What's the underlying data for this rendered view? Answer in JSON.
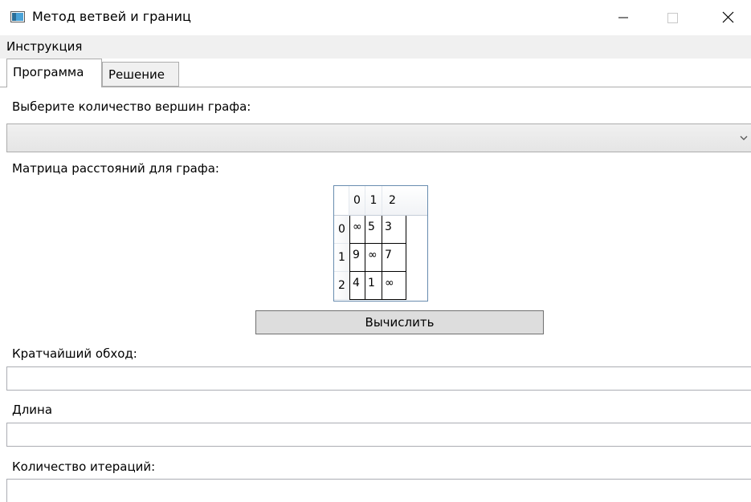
{
  "window": {
    "title": "Метод ветвей и границ",
    "minimize_symbol": "—",
    "maximize_symbol": "☐",
    "close_symbol": "✕",
    "icon": "app-window-icon"
  },
  "menu": {
    "items": [
      {
        "label": "Инструкция"
      }
    ]
  },
  "tabs": [
    {
      "label": "Программа",
      "selected": true
    },
    {
      "label": "Решение",
      "selected": false
    }
  ],
  "vertices": {
    "label": "Выберите количество вершин графа:",
    "selected": ""
  },
  "matrix": {
    "label": "Матрица расстояний для графа:",
    "column_headers": [
      "0",
      "1",
      "2"
    ],
    "row_headers": [
      "0",
      "1",
      "2"
    ],
    "rows": [
      [
        "∞",
        "5",
        "3"
      ],
      [
        "9",
        "∞",
        "7"
      ],
      [
        "4",
        "1",
        "∞"
      ]
    ]
  },
  "compute_button": {
    "label": "Вычислить"
  },
  "results": {
    "route_label": "Кратчайший обход:",
    "route_value": "",
    "length_label": "Длина",
    "length_value": "",
    "iterations_label": "Количество итераций:",
    "iterations_value": ""
  },
  "colors": {
    "grid_border": "#688caf",
    "button_bg": "#dddddd",
    "menu_bg": "#f0f0f0"
  }
}
